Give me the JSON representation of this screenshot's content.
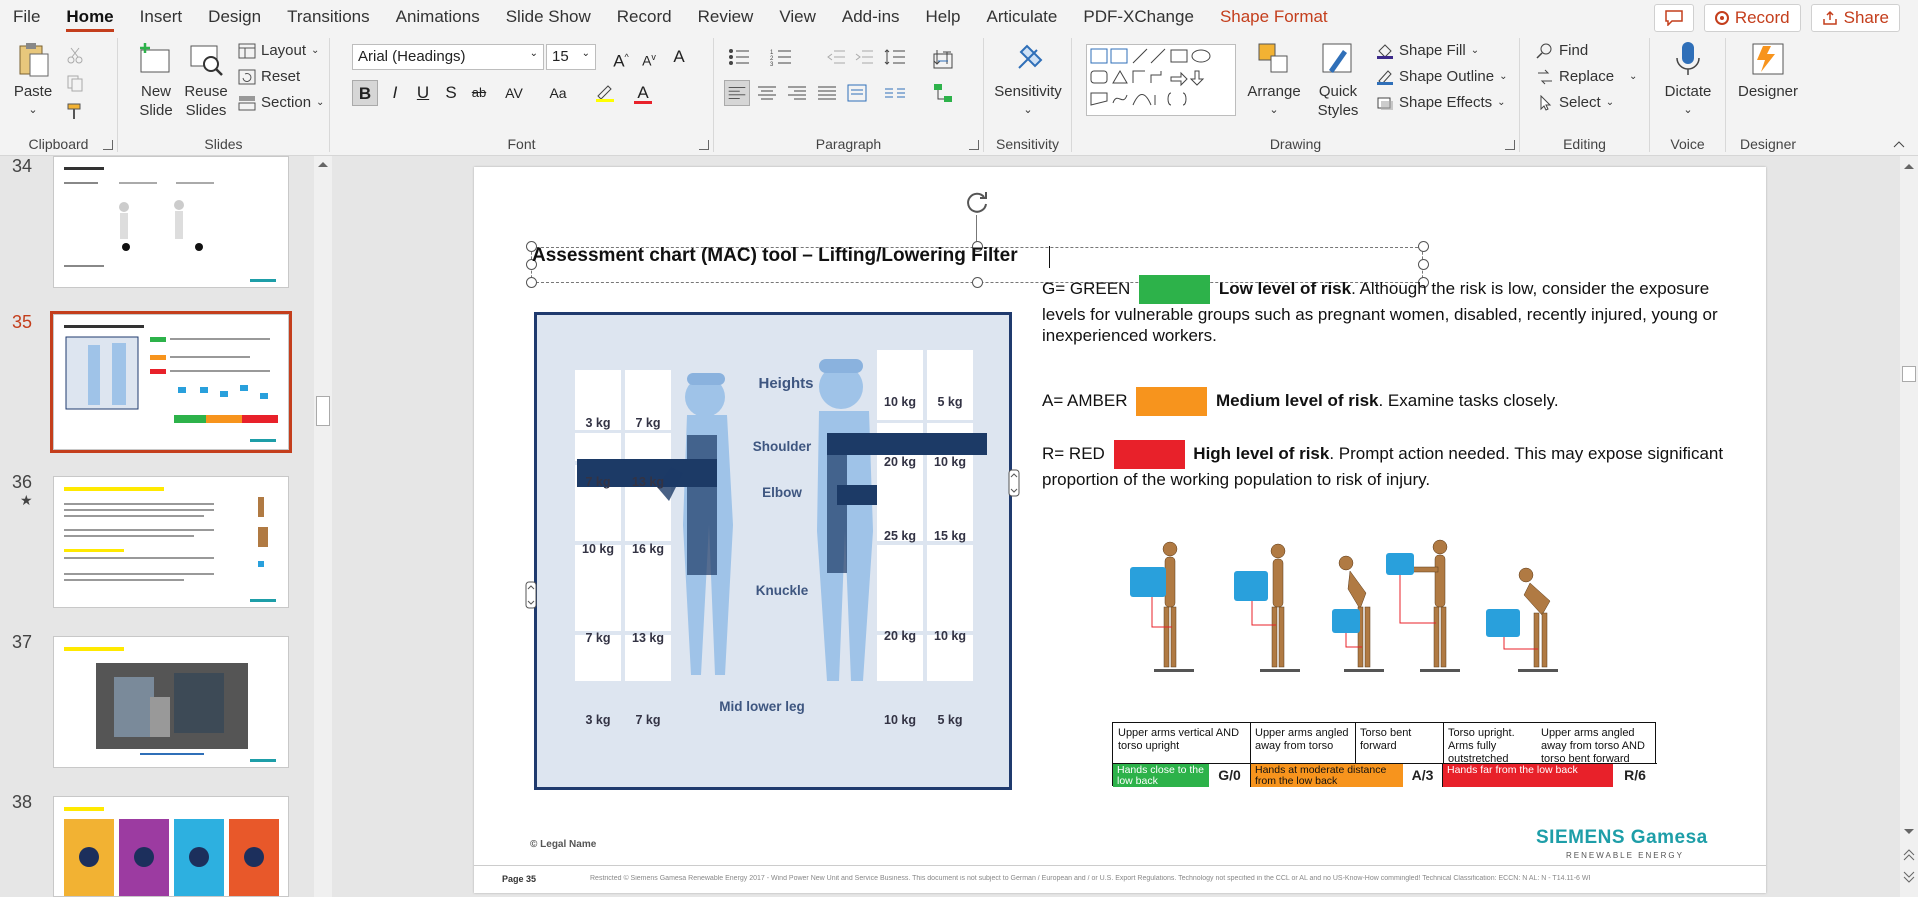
{
  "menu": {
    "items": [
      "File",
      "Home",
      "Insert",
      "Design",
      "Transitions",
      "Animations",
      "Slide Show",
      "Record",
      "Review",
      "View",
      "Add-ins",
      "Help",
      "Articulate",
      "PDF-XChange",
      "Shape Format"
    ],
    "active": "Home",
    "record_label": "Record",
    "share_label": "Share"
  },
  "ribbon": {
    "clipboard": {
      "label": "Clipboard",
      "paste": "Paste"
    },
    "slides": {
      "label": "Slides",
      "new_slide": "New Slide",
      "reuse_slides": "Reuse Slides",
      "layout": "Layout",
      "reset": "Reset",
      "section": "Section"
    },
    "font": {
      "label": "Font",
      "name": "Arial (Headings)",
      "size": "15"
    },
    "paragraph": {
      "label": "Paragraph"
    },
    "sensitivity": {
      "label": "Sensitivity",
      "button": "Sensitivity"
    },
    "drawing": {
      "label": "Drawing",
      "arrange": "Arrange",
      "quick_styles": "Quick Styles",
      "shape_fill": "Shape Fill",
      "shape_outline": "Shape Outline",
      "shape_effects": "Shape Effects"
    },
    "editing": {
      "label": "Editing",
      "find": "Find",
      "replace": "Replace",
      "select": "Select"
    },
    "voice": {
      "label": "Voice",
      "dictate": "Dictate"
    },
    "designer": {
      "label": "Designer",
      "button": "Designer"
    }
  },
  "thumbnails": [
    {
      "number": "34",
      "selected": false
    },
    {
      "number": "35",
      "selected": true
    },
    {
      "number": "36",
      "selected": false,
      "star": "★"
    },
    {
      "number": "37",
      "selected": false
    },
    {
      "number": "38",
      "selected": false
    }
  ],
  "slide": {
    "title": "Assessment chart (MAC) tool – Lifting/Lowering Filter",
    "legend": [
      {
        "prefix": "G= GREEN",
        "color": "#2db24a",
        "bold": "Low level of risk",
        "text": ". Although the risk is low, consider the exposure levels for vulnerable groups such as pregnant women, disabled, recently injured, young or inexperienced workers."
      },
      {
        "prefix": "A= AMBER",
        "color": "#f7941d",
        "bold": "Medium level of risk",
        "text": ". Examine tasks closely."
      },
      {
        "prefix": "R= RED",
        "color": "#e8212a",
        "bold": "High level of risk",
        "text": ". Prompt action needed. This may expose significant proportion of the working population to risk of injury."
      }
    ],
    "diagram": {
      "heights_title": "Heights",
      "height_labels": [
        "Shoulder",
        "Elbow",
        "Knuckle",
        "Mid lower leg"
      ],
      "female_col1": [
        "3 kg",
        "7 kg",
        "10 kg",
        "7 kg",
        "3 kg"
      ],
      "female_col2": [
        "7 kg",
        "13 kg",
        "16 kg",
        "13 kg",
        "7 kg"
      ],
      "male_col1": [
        "10 kg",
        "20 kg",
        "25 kg",
        "20 kg",
        "10 kg"
      ],
      "male_col2": [
        "5 kg",
        "10 kg",
        "15 kg",
        "10 kg",
        "5 kg"
      ]
    },
    "postures": {
      "descriptions": [
        "Upper arms vertical AND torso upright",
        "Upper arms angled away from torso",
        "Torso bent forward",
        "Torso upright. Arms fully outstretched",
        "Upper arms angled away from torso AND torso bent forward"
      ],
      "bands": [
        {
          "text": "Hands close to the low back",
          "code": "G/0",
          "color": "#2db24a"
        },
        {
          "text": "Hands at moderate distance from the low back",
          "code": "A/3",
          "color": "#f7941d"
        },
        {
          "text": "Hands far from the low back",
          "code": "R/6",
          "color": "#e8212a"
        }
      ]
    },
    "legal": "© Legal Name",
    "page": "Page 35",
    "brand_name": "SIEMENS Gamesa",
    "brand_sub": "RENEWABLE ENERGY",
    "footer_note": "Restricted © Siemens Gamesa Renewable Energy 2017 - Wind Power New Unit and Service Business. This document is not subject to German / European and / or U.S. Export Regulations. Technology not specified in the CCL or AL and no US-Know-How commingled! Technical Classification: ECCN: N AL: N - T14.11-6 WP SE CS OPS TR GTS"
  }
}
